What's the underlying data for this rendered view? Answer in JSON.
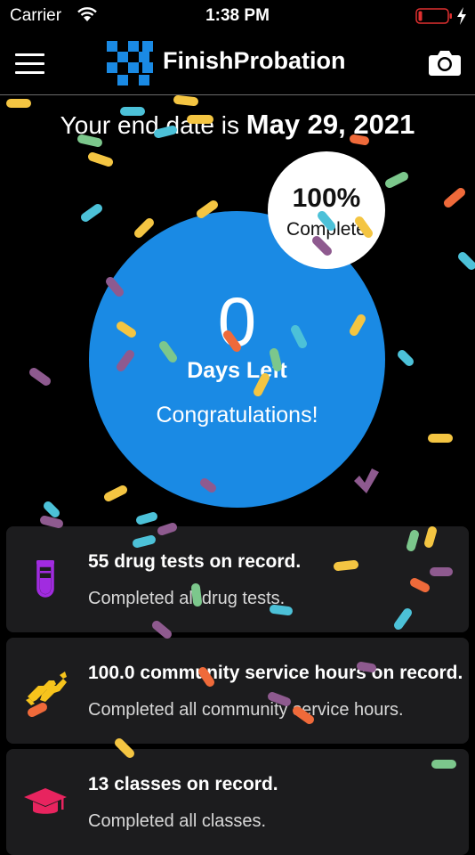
{
  "status_bar": {
    "carrier": "Carrier",
    "time": "1:38 PM"
  },
  "nav": {
    "brand": "FinishProbation"
  },
  "end_date": {
    "prefix": "Your end date is ",
    "date": "May 29, 2021"
  },
  "progress": {
    "days_left": "0",
    "days_label": "Days Left",
    "message": "Congratulations!",
    "percent": "100%",
    "percent_label": "Complete"
  },
  "cards": [
    {
      "title": "55 drug tests on record.",
      "subtitle": "Completed all drug tests.",
      "icon": "test-tube-icon",
      "color": "#a12be0"
    },
    {
      "title": "100.0 community service hours on record.",
      "subtitle": "Completed all community service hours.",
      "icon": "handshake-icon",
      "color": "#f6c31c"
    },
    {
      "title": "13 classes on record.",
      "subtitle": "Completed all classes.",
      "icon": "graduation-cap-icon",
      "color": "#e8245f"
    }
  ],
  "colors": {
    "accent": "#1a8ae4",
    "card": "#1c1c1e",
    "background": "#000000"
  }
}
